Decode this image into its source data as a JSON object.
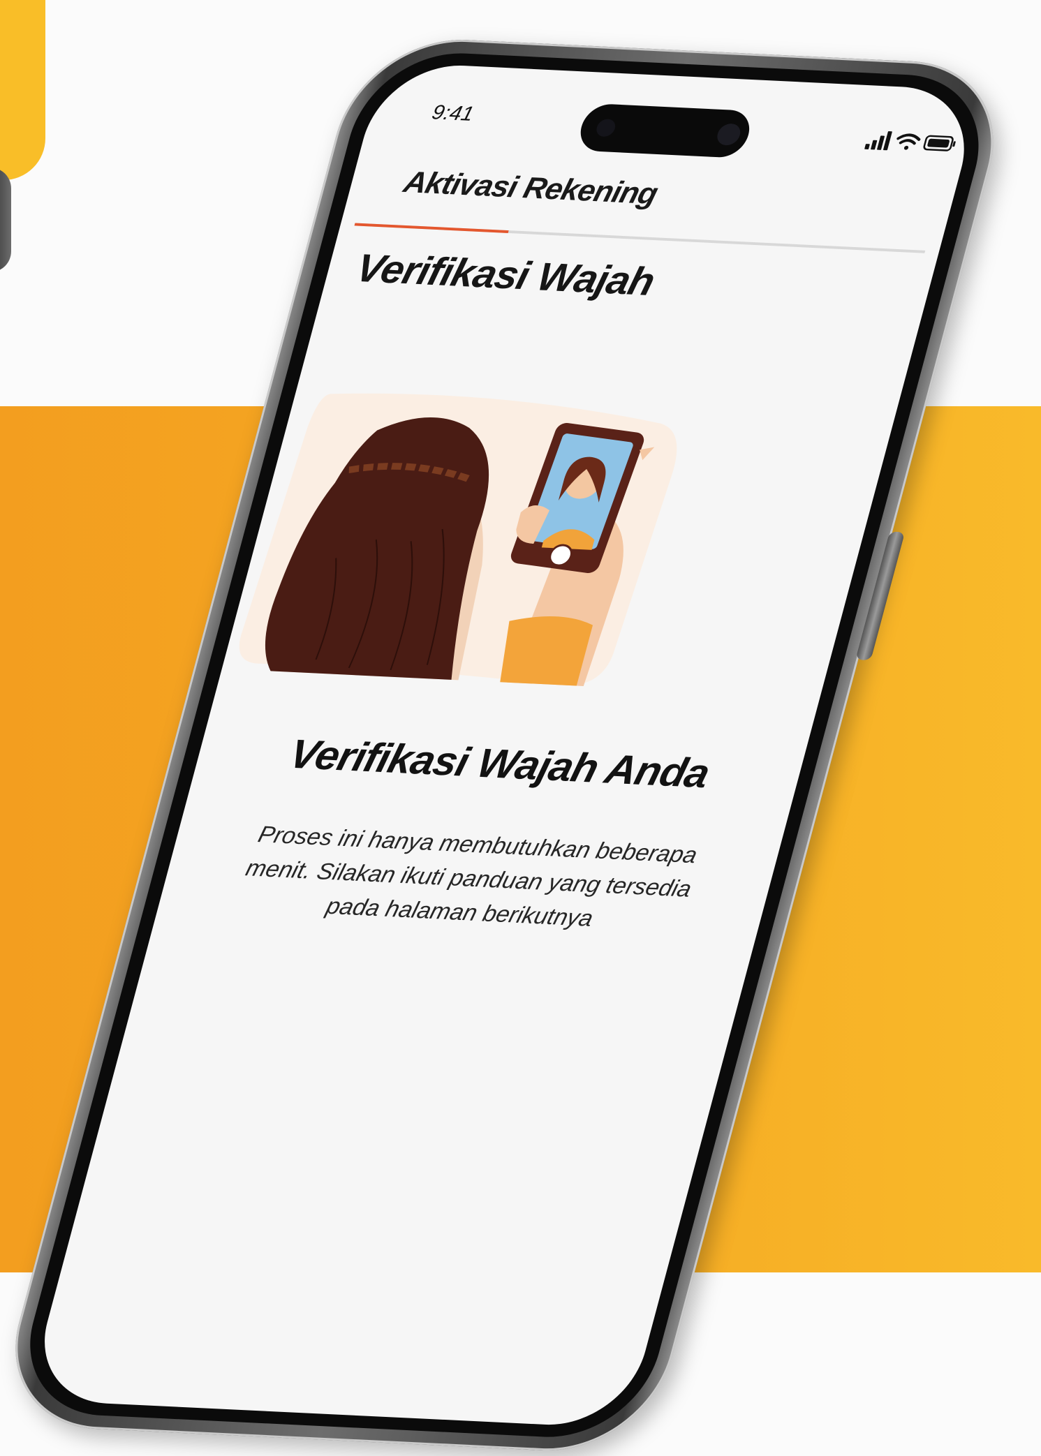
{
  "colors": {
    "accent": "#e4572e",
    "background_band": "#f5a623",
    "background_top": "#fbfbfb",
    "screen": "#f6f6f6"
  },
  "status_bar": {
    "time": "9:41",
    "icons": [
      "signal-icon",
      "wifi-icon",
      "battery-icon"
    ]
  },
  "header": {
    "title": "Aktivasi Rekening",
    "progress": 0.27
  },
  "main": {
    "section_title": "Verifikasi Wajah",
    "illustration": "face-selfie-illustration",
    "headline": "Verifikasi Wajah Anda",
    "description": "Proses ini hanya membutuhkan beberapa menit. Silakan ikuti panduan yang tersedia pada halaman berikutnya"
  }
}
